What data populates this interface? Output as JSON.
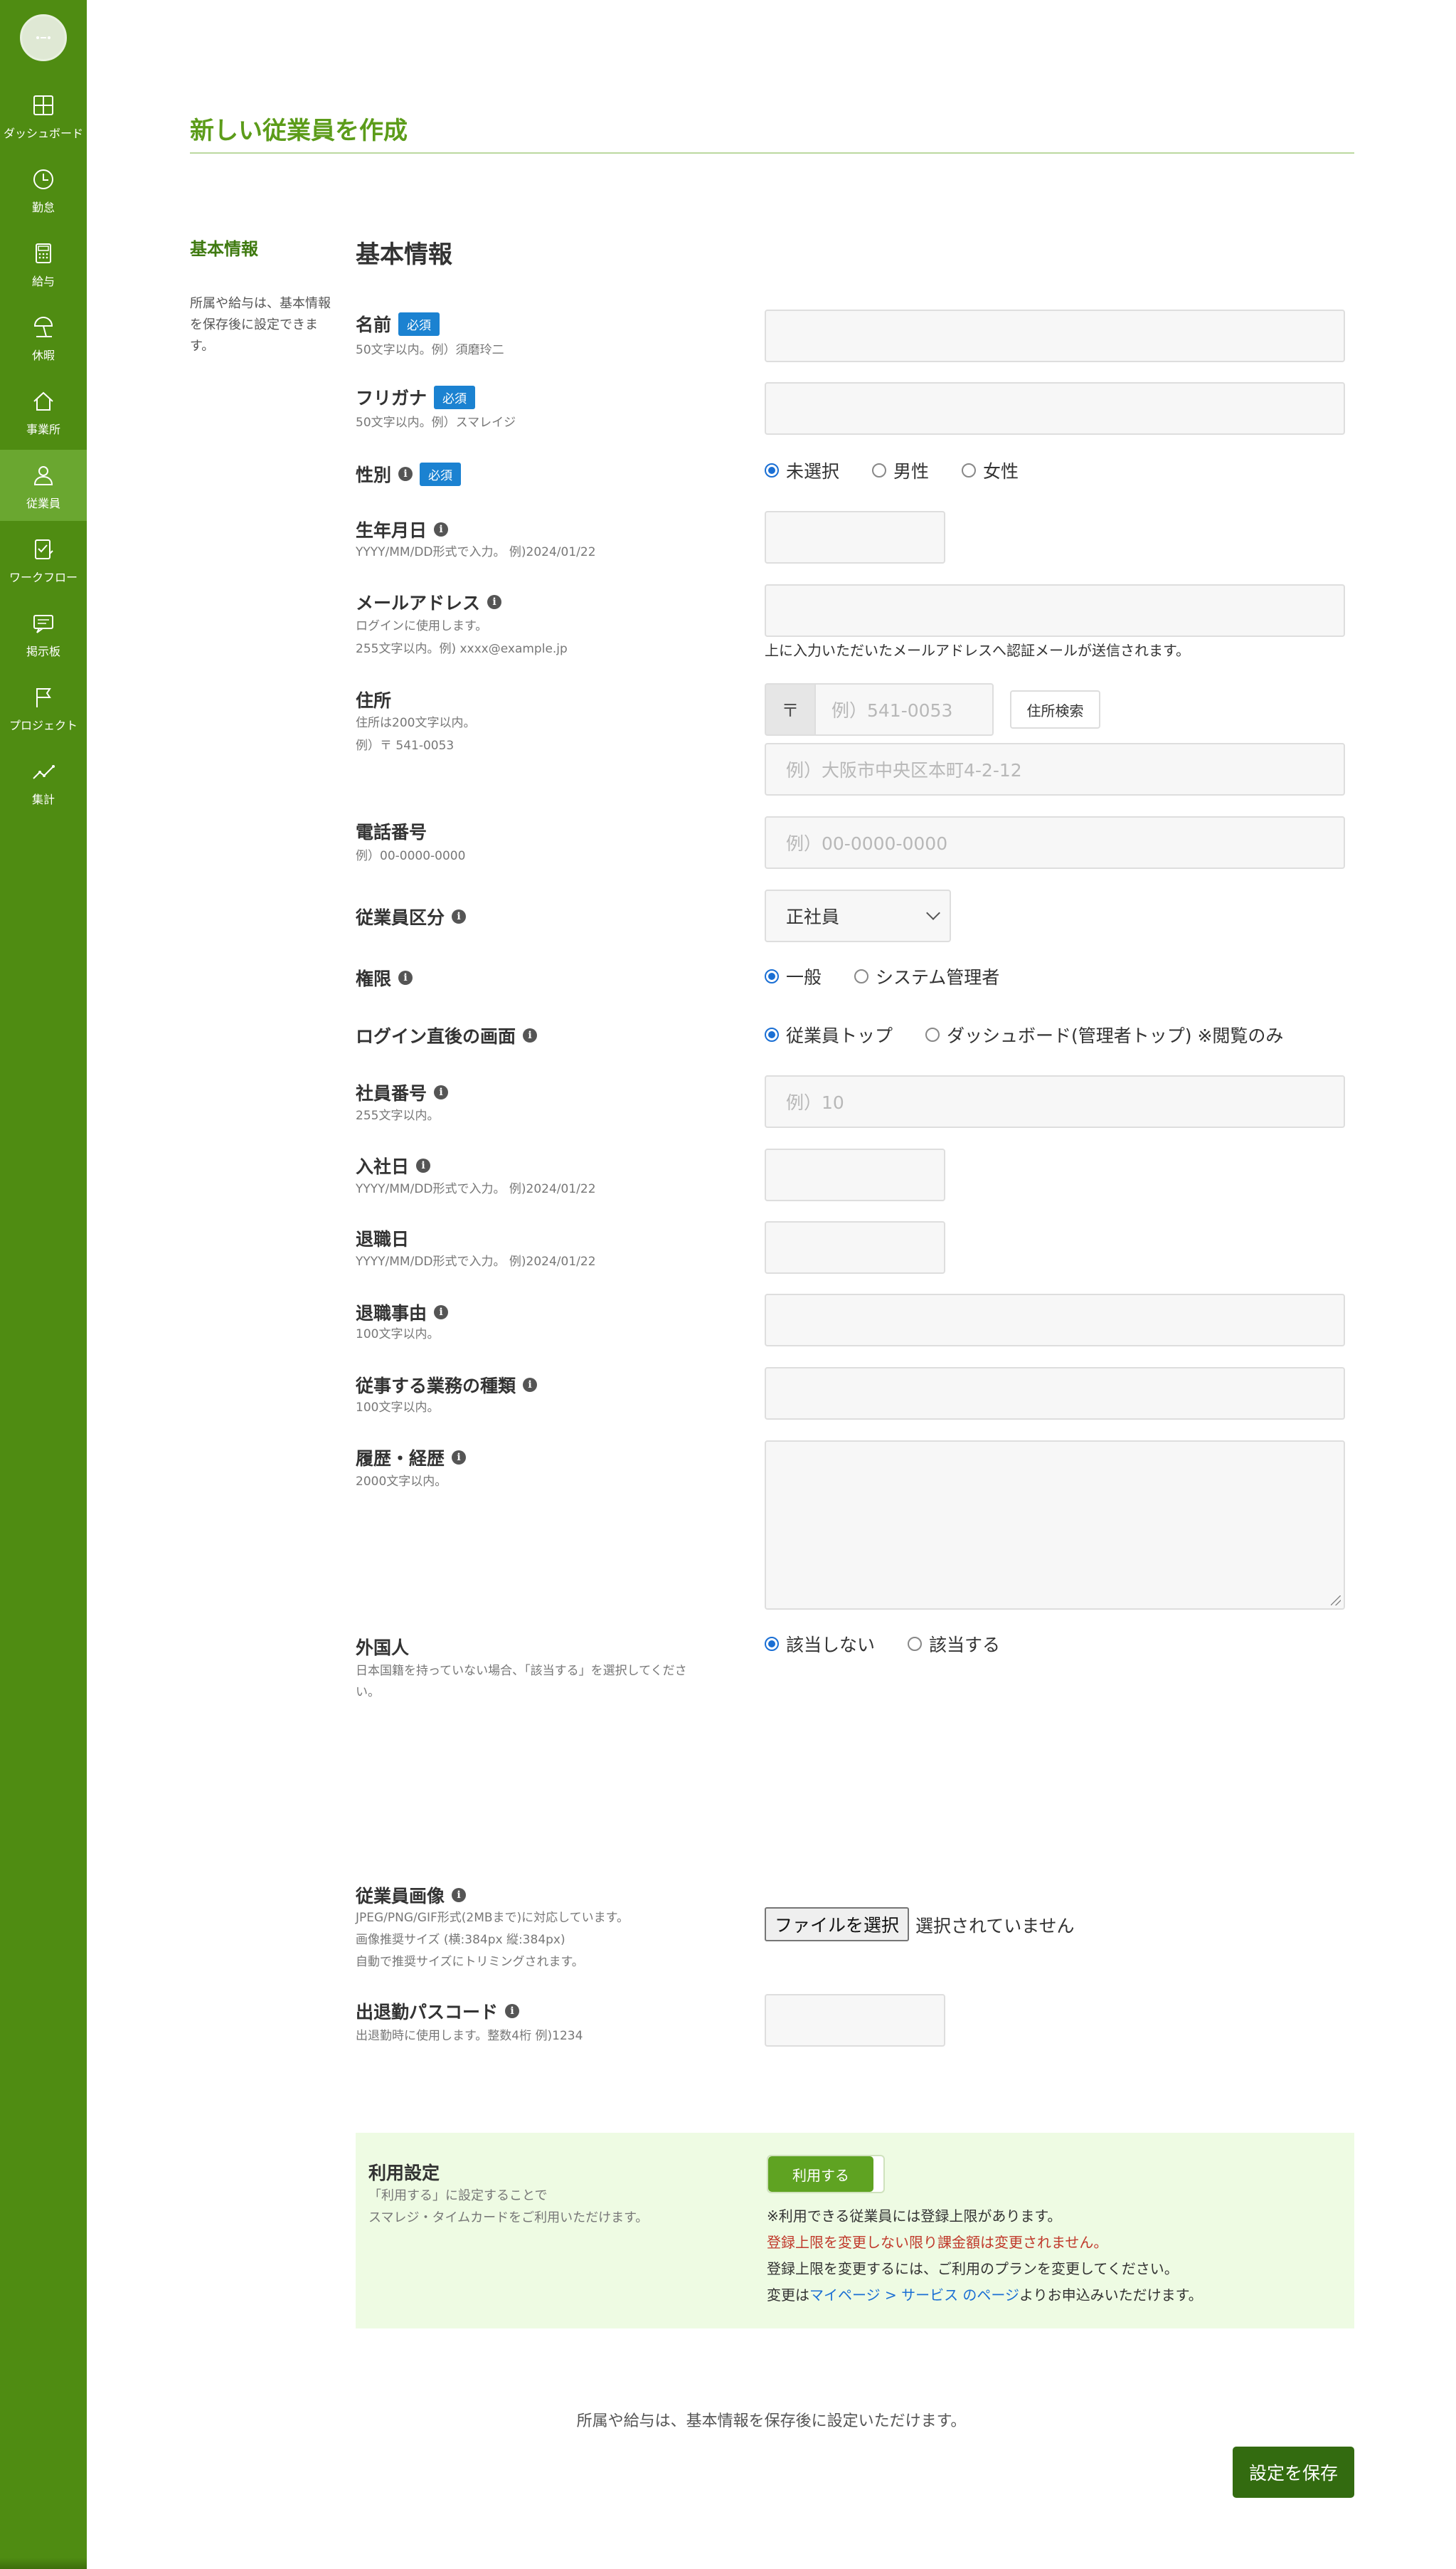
{
  "sidebar": {
    "items": [
      {
        "label": "ダッシュボード",
        "icon": "dashboard-icon"
      },
      {
        "label": "勤怠",
        "icon": "clock-icon"
      },
      {
        "label": "給与",
        "icon": "calculator-icon"
      },
      {
        "label": "休暇",
        "icon": "beach-umbrella-icon"
      },
      {
        "label": "事業所",
        "icon": "home-icon"
      },
      {
        "label": "従業員",
        "icon": "person-icon",
        "active": true
      },
      {
        "label": "ワークフロー",
        "icon": "checklist-icon"
      },
      {
        "label": "掲示板",
        "icon": "chat-icon"
      },
      {
        "label": "プロジェクト",
        "icon": "flag-icon"
      },
      {
        "label": "集計",
        "icon": "chart-line-icon"
      }
    ]
  },
  "page": {
    "title": "新しい従業員を作成"
  },
  "section": {
    "label": "基本情報",
    "desc": "所属や給与は、基本情報を保存後に設定できます。",
    "heading": "基本情報"
  },
  "required_badge": "必須",
  "info_glyph": "i",
  "fields": {
    "name": {
      "label": "名前",
      "hint": "50文字以内。例）須磨玲二"
    },
    "kana": {
      "label": "フリガナ",
      "hint": "50文字以内。例）スマレイジ"
    },
    "gender": {
      "label": "性別",
      "options": [
        "未選択",
        "男性",
        "女性"
      ],
      "selected": "未選択"
    },
    "birthday": {
      "label": "生年月日",
      "hint": "YYYY/MM/DD形式で入力。 例)2024/01/22"
    },
    "email": {
      "label": "メールアドレス",
      "hint1": "ログインに使用します。",
      "hint2": "255文字以内。例) xxxx@example.jp",
      "note": "上に入力いただいたメールアドレスへ認証メールが送信されます。"
    },
    "address": {
      "label": "住所",
      "hint1": "住所は200文字以内。",
      "hint2": "例）〒 541-0053",
      "zip_prefix": "〒",
      "zip_placeholder": "例）541-0053",
      "search_button": "住所検索",
      "address_placeholder": "例）大阪市中央区本町4-2-12"
    },
    "phone": {
      "label": "電話番号",
      "hint": "例）00-0000-0000",
      "placeholder": "例）00-0000-0000"
    },
    "employee_type": {
      "label": "従業員区分",
      "value": "正社員"
    },
    "permission": {
      "label": "権限",
      "options": [
        "一般",
        "システム管理者"
      ],
      "selected": "一般"
    },
    "login_screen": {
      "label": "ログイン直後の画面",
      "options": [
        "従業員トップ",
        "ダッシュボード(管理者トップ) ※閲覧のみ"
      ],
      "selected": "従業員トップ"
    },
    "employee_number": {
      "label": "社員番号",
      "hint": "255文字以内。",
      "placeholder": "例）10"
    },
    "hire_date": {
      "label": "入社日",
      "hint": "YYYY/MM/DD形式で入力。 例)2024/01/22"
    },
    "retire_date": {
      "label": "退職日",
      "hint": "YYYY/MM/DD形式で入力。 例)2024/01/22"
    },
    "retire_reason": {
      "label": "退職事由",
      "hint": "100文字以内。"
    },
    "job_type": {
      "label": "従事する業務の種類",
      "hint": "100文字以内。"
    },
    "career": {
      "label": "履歴・経歴",
      "hint": "2000文字以内。"
    },
    "foreigner": {
      "label": "外国人",
      "hint1": "日本国籍を持っていない場合、「該当する」を選択してくださ",
      "hint2": "い。",
      "options": [
        "該当しない",
        "該当する"
      ],
      "selected": "該当しない"
    },
    "photo": {
      "label": "従業員画像",
      "hint1": "JPEG/PNG/GIF形式(2MBまで)に対応しています。",
      "hint2": "画像推奨サイズ (横:384px 縦:384px)",
      "hint3": "自動で推奨サイズにトリミングされます。",
      "file_button": "ファイルを選択",
      "file_status": "選択されていません"
    },
    "passcode": {
      "label": "出退勤パスコード",
      "hint": "出退勤時に使用します。整数4桁 例)1234"
    }
  },
  "usage": {
    "title": "利用設定",
    "desc1": "「利用する」に設定することで",
    "desc2": "スマレジ・タイムカードをご利用いただけます。",
    "toggle_label": "利用する",
    "line1": "※利用できる従業員には登録上限があります。",
    "line2": "登録上限を変更しない限り課金額は変更されません。",
    "line3": "登録上限を変更するには、ご利用のプランを変更してください。",
    "line4_pre": "変更は",
    "line4_link": "マイページ > サービス のページ",
    "line4_post": "よりお申込みいただけます。"
  },
  "footer": {
    "note": "所属や給与は、基本情報を保存後に設定いただけます。",
    "save_button": "設定を保存"
  },
  "colors": {
    "sidebar": "#4f8c12",
    "sidebar_active": "#6aa730",
    "accent": "#5c9c1a",
    "badge": "#1b82d1",
    "save_button": "#336b10",
    "usage_bg": "#eefbe3",
    "warning_text": "#c0392b",
    "link": "#1a6fd4"
  }
}
